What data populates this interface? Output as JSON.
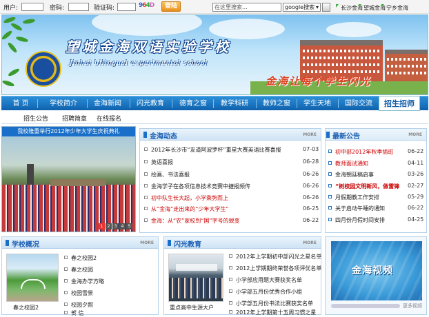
{
  "topbar": {
    "user_label": "用户:",
    "password_label": "密码:",
    "captcha_label": "验证码:",
    "captcha_chars": [
      "9",
      "6",
      "4",
      "D"
    ],
    "login_label": "登陆",
    "search_placeholder": "在这里搜索...",
    "search_engine": "google搜索",
    "links": [
      "长沙金海",
      "望城金海",
      "宁乡金海"
    ]
  },
  "banner": {
    "title": "望城金海双语实验学校",
    "subtitle": "Jinhai bilingual experimental school",
    "slogan": "金海让每个学生闪光"
  },
  "nav": {
    "items": [
      "首 页",
      "学校简介",
      "金海新闻",
      "闪光教育",
      "德育之窗",
      "教学科研",
      "教师之窗",
      "学生天地",
      "国际交流"
    ],
    "active": "招生招师"
  },
  "subnav": {
    "items": [
      "招生公告",
      "招聘简章",
      "在线报名"
    ]
  },
  "photo_news": {
    "caption": "我校隆重举行2012年少年大学生庆祝典礼",
    "pager": [
      "1",
      "2",
      "3",
      "4",
      "5"
    ]
  },
  "news": {
    "title": "金海动态",
    "more": "MORE",
    "items": [
      {
        "text": "2012年长沙市“友道阿波罗杯”重星大赛英语比赛喜报",
        "date": "07-03",
        "color": "#222"
      },
      {
        "text": "英语喜报",
        "date": "06-28",
        "color": "#222"
      },
      {
        "text": "绘画、书法喜报",
        "date": "06-26",
        "color": "#222"
      },
      {
        "text": "金海学子在各项信息技术竞赛中捷报频传",
        "date": "06-26",
        "color": "#222"
      },
      {
        "text": "初中队生长大起，小学乘势而上",
        "date": "06-26",
        "color": "#c00"
      },
      {
        "text": "从“金海”走出来的“少年大学生”",
        "date": "06-25",
        "color": "#c00"
      },
      {
        "text": "金海：从“农”家校到“国”字号的蜕变",
        "date": "06-22",
        "color": "#c00"
      }
    ]
  },
  "notices": {
    "title": "最新公告",
    "more": "MORE",
    "items": [
      {
        "text": "初中部2012年秋季插班",
        "date": "06-22",
        "color": "#c00"
      },
      {
        "text": "教师面试通知",
        "date": "04-11",
        "color": "#c00"
      },
      {
        "text": "金海朝廷稿启事",
        "date": "03-26",
        "color": "#222"
      },
      {
        "text": "“树校园文明新风，做雷锋",
        "date": "02-27",
        "color": "#c00"
      },
      {
        "text": "月假期教工作安排",
        "date": "05-29",
        "color": "#222"
      },
      {
        "text": "关于启动午睡的通知",
        "date": "06-22",
        "color": "#222"
      },
      {
        "text": "四月份月假时间安排",
        "date": "04-25",
        "color": "#222"
      }
    ]
  },
  "school": {
    "title": "学校概况",
    "more": "MORE",
    "photo_caption": "春之校园2",
    "items": [
      "春之校园2",
      "春之校园",
      "金海办学方略",
      "校园雪景",
      "校园夕照",
      "贺 信"
    ]
  },
  "shining": {
    "title": "闪光教育",
    "more": "MORE",
    "photo_caption": "重点高中生源大户",
    "items": [
      "2012年上学期初中部闪光之星名单",
      "2012上学期期终荣誉各项评优名单",
      "小学部应用题大赛获奖名单",
      "小学部五月份优秀合作小组",
      "小学部五月份书法比赛获奖名单",
      "2012年上学期第十五周习惯之星"
    ]
  },
  "video": {
    "label": "金海视频",
    "more": "更多视频"
  }
}
